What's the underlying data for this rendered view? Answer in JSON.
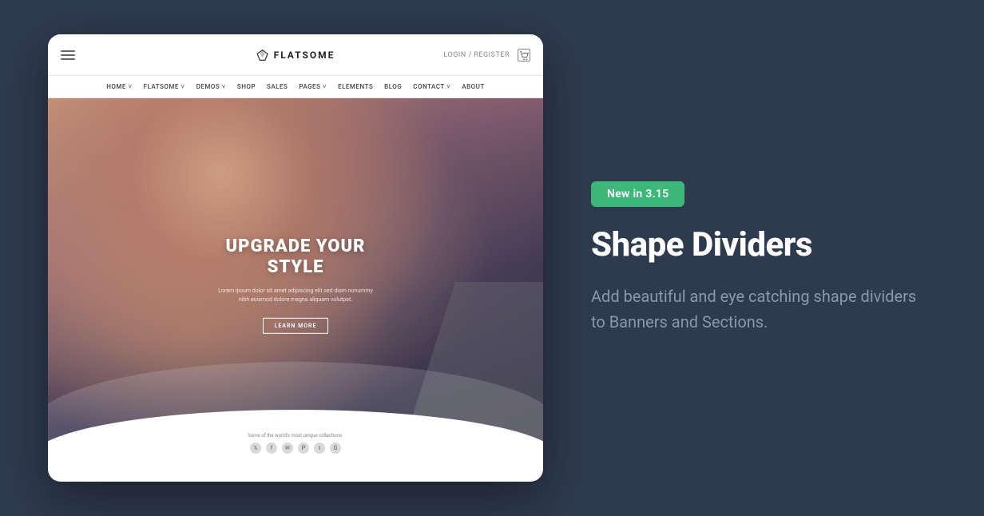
{
  "layout": {
    "background_color": "#2e3a4e"
  },
  "browser": {
    "brand": "FLATSOME",
    "login_text": "LOGIN / REGISTER",
    "nav_items": [
      "HOME",
      "FLATSOME",
      "DEMOS",
      "SHOP",
      "SALES",
      "PAGES",
      "ELEMENTS",
      "BLOG",
      "CONTACT",
      "ABOUT"
    ],
    "hero": {
      "title_line1": "UPGRADE YOUR",
      "title_line2": "STYLE",
      "subtitle": "Lorem ipsum dolor sit amet adipiscing elit sed diam nonummy nibh euismod dolore magna aliquam volutpat.",
      "cta_button": "LEARN MORE",
      "footer_text": "Some of the world's most unique collections·"
    }
  },
  "info_panel": {
    "badge": "New  in 3.15",
    "title": "Shape Dividers",
    "description": "Add beautiful and eye catching shape dividers to Banners and Sections."
  },
  "colors": {
    "badge_bg": "#3db87a",
    "panel_bg": "#2e3a4e",
    "title_color": "#ffffff",
    "description_color": "#8899aa",
    "badge_text": "#ffffff"
  }
}
